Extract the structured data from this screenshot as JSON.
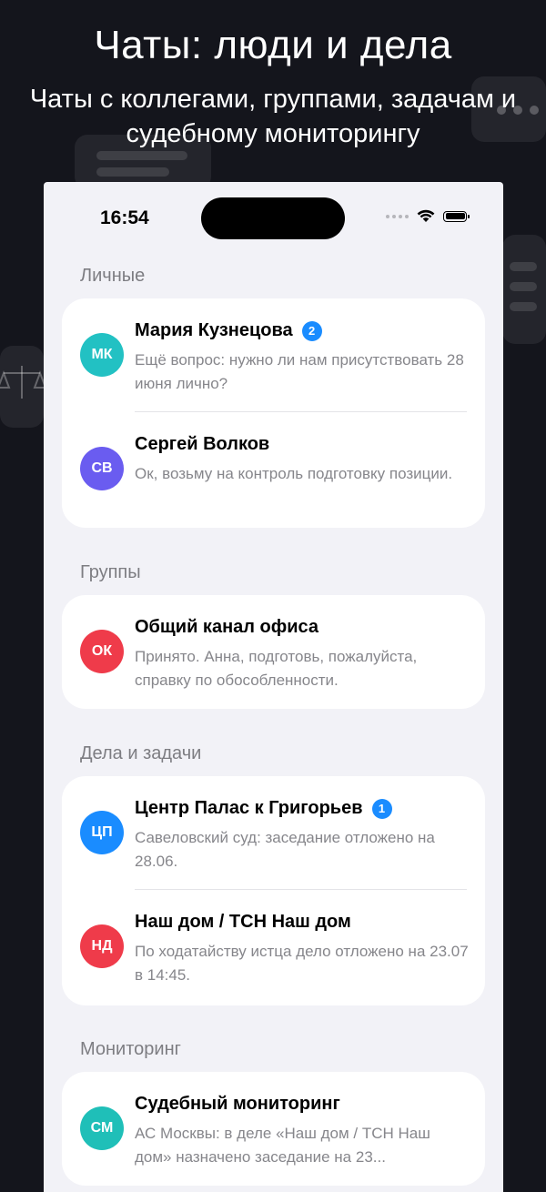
{
  "promo": {
    "title": "Чаты: люди и дела",
    "subtitle": "Чаты с коллегами, группами, задачам и судебному мониторингу"
  },
  "status_bar": {
    "time": "16:54"
  },
  "sections": [
    {
      "title": "Личные",
      "chats": [
        {
          "initials": "МК",
          "name": "Мария Кузнецова",
          "badge": "2",
          "preview": "Ещё вопрос: нужно ли нам присутствовать 28 июня лично?",
          "avatar_color": "#22c1c3"
        },
        {
          "initials": "СВ",
          "name": "Сергей Волков",
          "badge": "",
          "preview": "Ок, возьму на контроль подготовку позиции.",
          "avatar_color": "#6a5cf0"
        }
      ]
    },
    {
      "title": "Группы",
      "chats": [
        {
          "initials": "ОК",
          "name": "Общий канал офиса",
          "badge": "",
          "preview": "Принято. Анна, подготовь, пожалуйста, справку по обособленности.",
          "avatar_color": "#ef3b4a"
        }
      ]
    },
    {
      "title": "Дела и задачи",
      "chats": [
        {
          "initials": "ЦП",
          "name": "Центр Палас к Григорьев",
          "badge": "1",
          "preview": "Савеловский суд: заседание отложено на 28.06.",
          "avatar_color": "#1a8cff"
        },
        {
          "initials": "НД",
          "name": "Наш дом / ТСН Наш дом",
          "badge": "",
          "preview": "По ходатайству истца дело отложено на 23.07 в 14:45.",
          "avatar_color": "#ef3b4a"
        }
      ]
    },
    {
      "title": "Мониторинг",
      "chats": [
        {
          "initials": "СМ",
          "name": "Судебный мониторинг",
          "badge": "",
          "preview": "АС Москвы: в деле «Наш дом / ТСН Наш дом» назначено заседание на 23...",
          "avatar_color": "#1fbfb8"
        }
      ]
    }
  ],
  "colors": {
    "badge": "#1a8cff",
    "screen_bg": "#f2f2f7",
    "promo_bg": "#14151c"
  }
}
